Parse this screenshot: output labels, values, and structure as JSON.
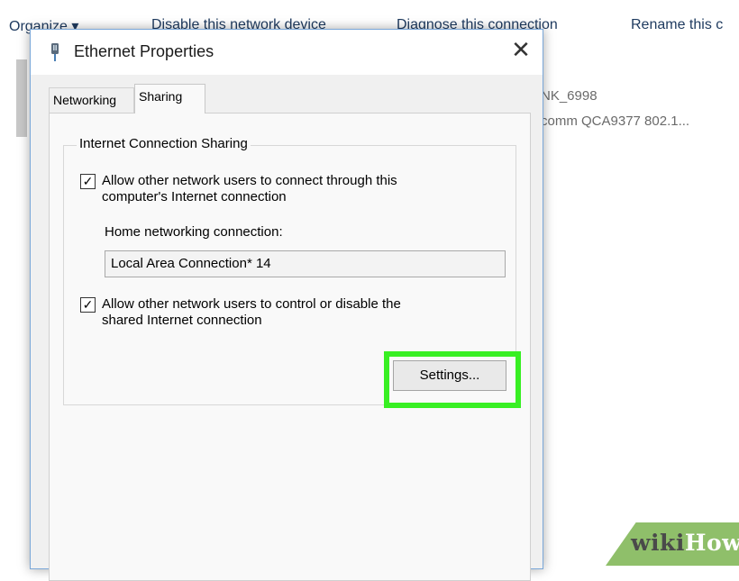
{
  "explorer": {
    "toolbar": [
      "Organize ▾",
      "Disable this network device",
      "Diagnose this connection",
      "Rename this c"
    ],
    "adapter_name": "NK_6998",
    "adapter_desc": "comm QCA9377 802.1..."
  },
  "dialog": {
    "title": "Ethernet Properties",
    "close_glyph": "✕",
    "tabs": [
      {
        "label": "Networking",
        "active": false
      },
      {
        "label": "Sharing",
        "active": true
      }
    ],
    "group_title": "Internet Connection Sharing",
    "allow_connect": {
      "checked": true,
      "glyph": "✓",
      "line1": "Allow other network users to connect through this",
      "line2": "computer's Internet connection"
    },
    "home_label": "Home networking connection:",
    "home_value": "Local Area Connection* 14",
    "allow_control": {
      "checked": true,
      "glyph": "✓",
      "line1": "Allow other network users to control or disable the",
      "line2": "shared Internet connection"
    },
    "settings_label": "Settings...",
    "highlight_color": "#38ef23"
  },
  "watermark": {
    "part1": "wiki",
    "part2": "How"
  }
}
